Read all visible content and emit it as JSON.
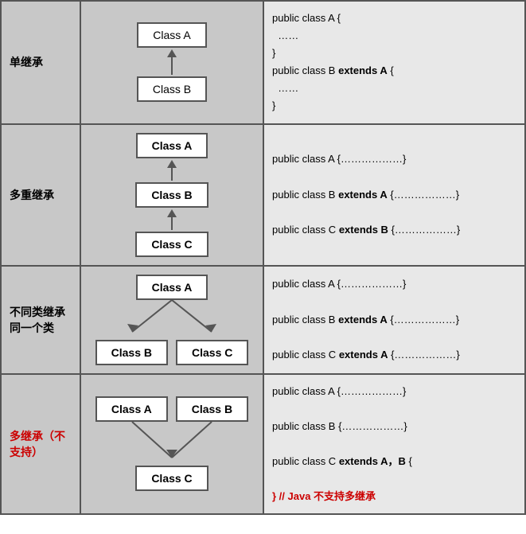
{
  "rows": [
    {
      "id": "single-inheritance",
      "label": "单继承",
      "label_red": false,
      "code_lines": [
        {
          "text": "public class A {",
          "bold_parts": []
        },
        {
          "text": "……",
          "bold_parts": []
        },
        {
          "text": "}",
          "bold_parts": []
        },
        {
          "text": "public class B extends A {",
          "bold_parts": [
            "extends A"
          ]
        },
        {
          "text": "……",
          "bold_parts": []
        },
        {
          "text": "}",
          "bold_parts": []
        }
      ]
    },
    {
      "id": "multi-level",
      "label": "多重继承",
      "label_red": false,
      "code_lines": [
        {
          "text": "public class A {………………}",
          "bold_parts": []
        },
        {
          "text": "",
          "bold_parts": []
        },
        {
          "text": "public class B extends A {………………}",
          "bold_parts": [
            "extends A"
          ]
        },
        {
          "text": "",
          "bold_parts": []
        },
        {
          "text": "public class C extends B {………………}",
          "bold_parts": [
            "extends B"
          ]
        }
      ]
    },
    {
      "id": "same-parent",
      "label": "不同类继承同一个类",
      "label_red": false,
      "code_lines": [
        {
          "text": "public class A {………………}",
          "bold_parts": []
        },
        {
          "text": "",
          "bold_parts": []
        },
        {
          "text": "public class B extends A {………………}",
          "bold_parts": [
            "extends A"
          ]
        },
        {
          "text": "",
          "bold_parts": []
        },
        {
          "text": "public class C extends A {………………}",
          "bold_parts": [
            "extends A"
          ]
        }
      ]
    },
    {
      "id": "multiple-inheritance",
      "label": "多继承（不支持）",
      "label_red": true,
      "code_lines": [
        {
          "text": "public class A {………………}",
          "bold_parts": []
        },
        {
          "text": "",
          "bold_parts": []
        },
        {
          "text": "public class B {………………}",
          "bold_parts": []
        },
        {
          "text": "",
          "bold_parts": []
        },
        {
          "text": "public class C extends A，B {",
          "bold_parts": [
            "extends A，B"
          ]
        },
        {
          "text": "",
          "bold_parts": []
        },
        {
          "text": "} // Java 不支持多继承",
          "bold_parts": [],
          "red": true
        }
      ]
    }
  ],
  "classes": {
    "A": "Class A",
    "B": "Class B",
    "C": "Class C"
  }
}
